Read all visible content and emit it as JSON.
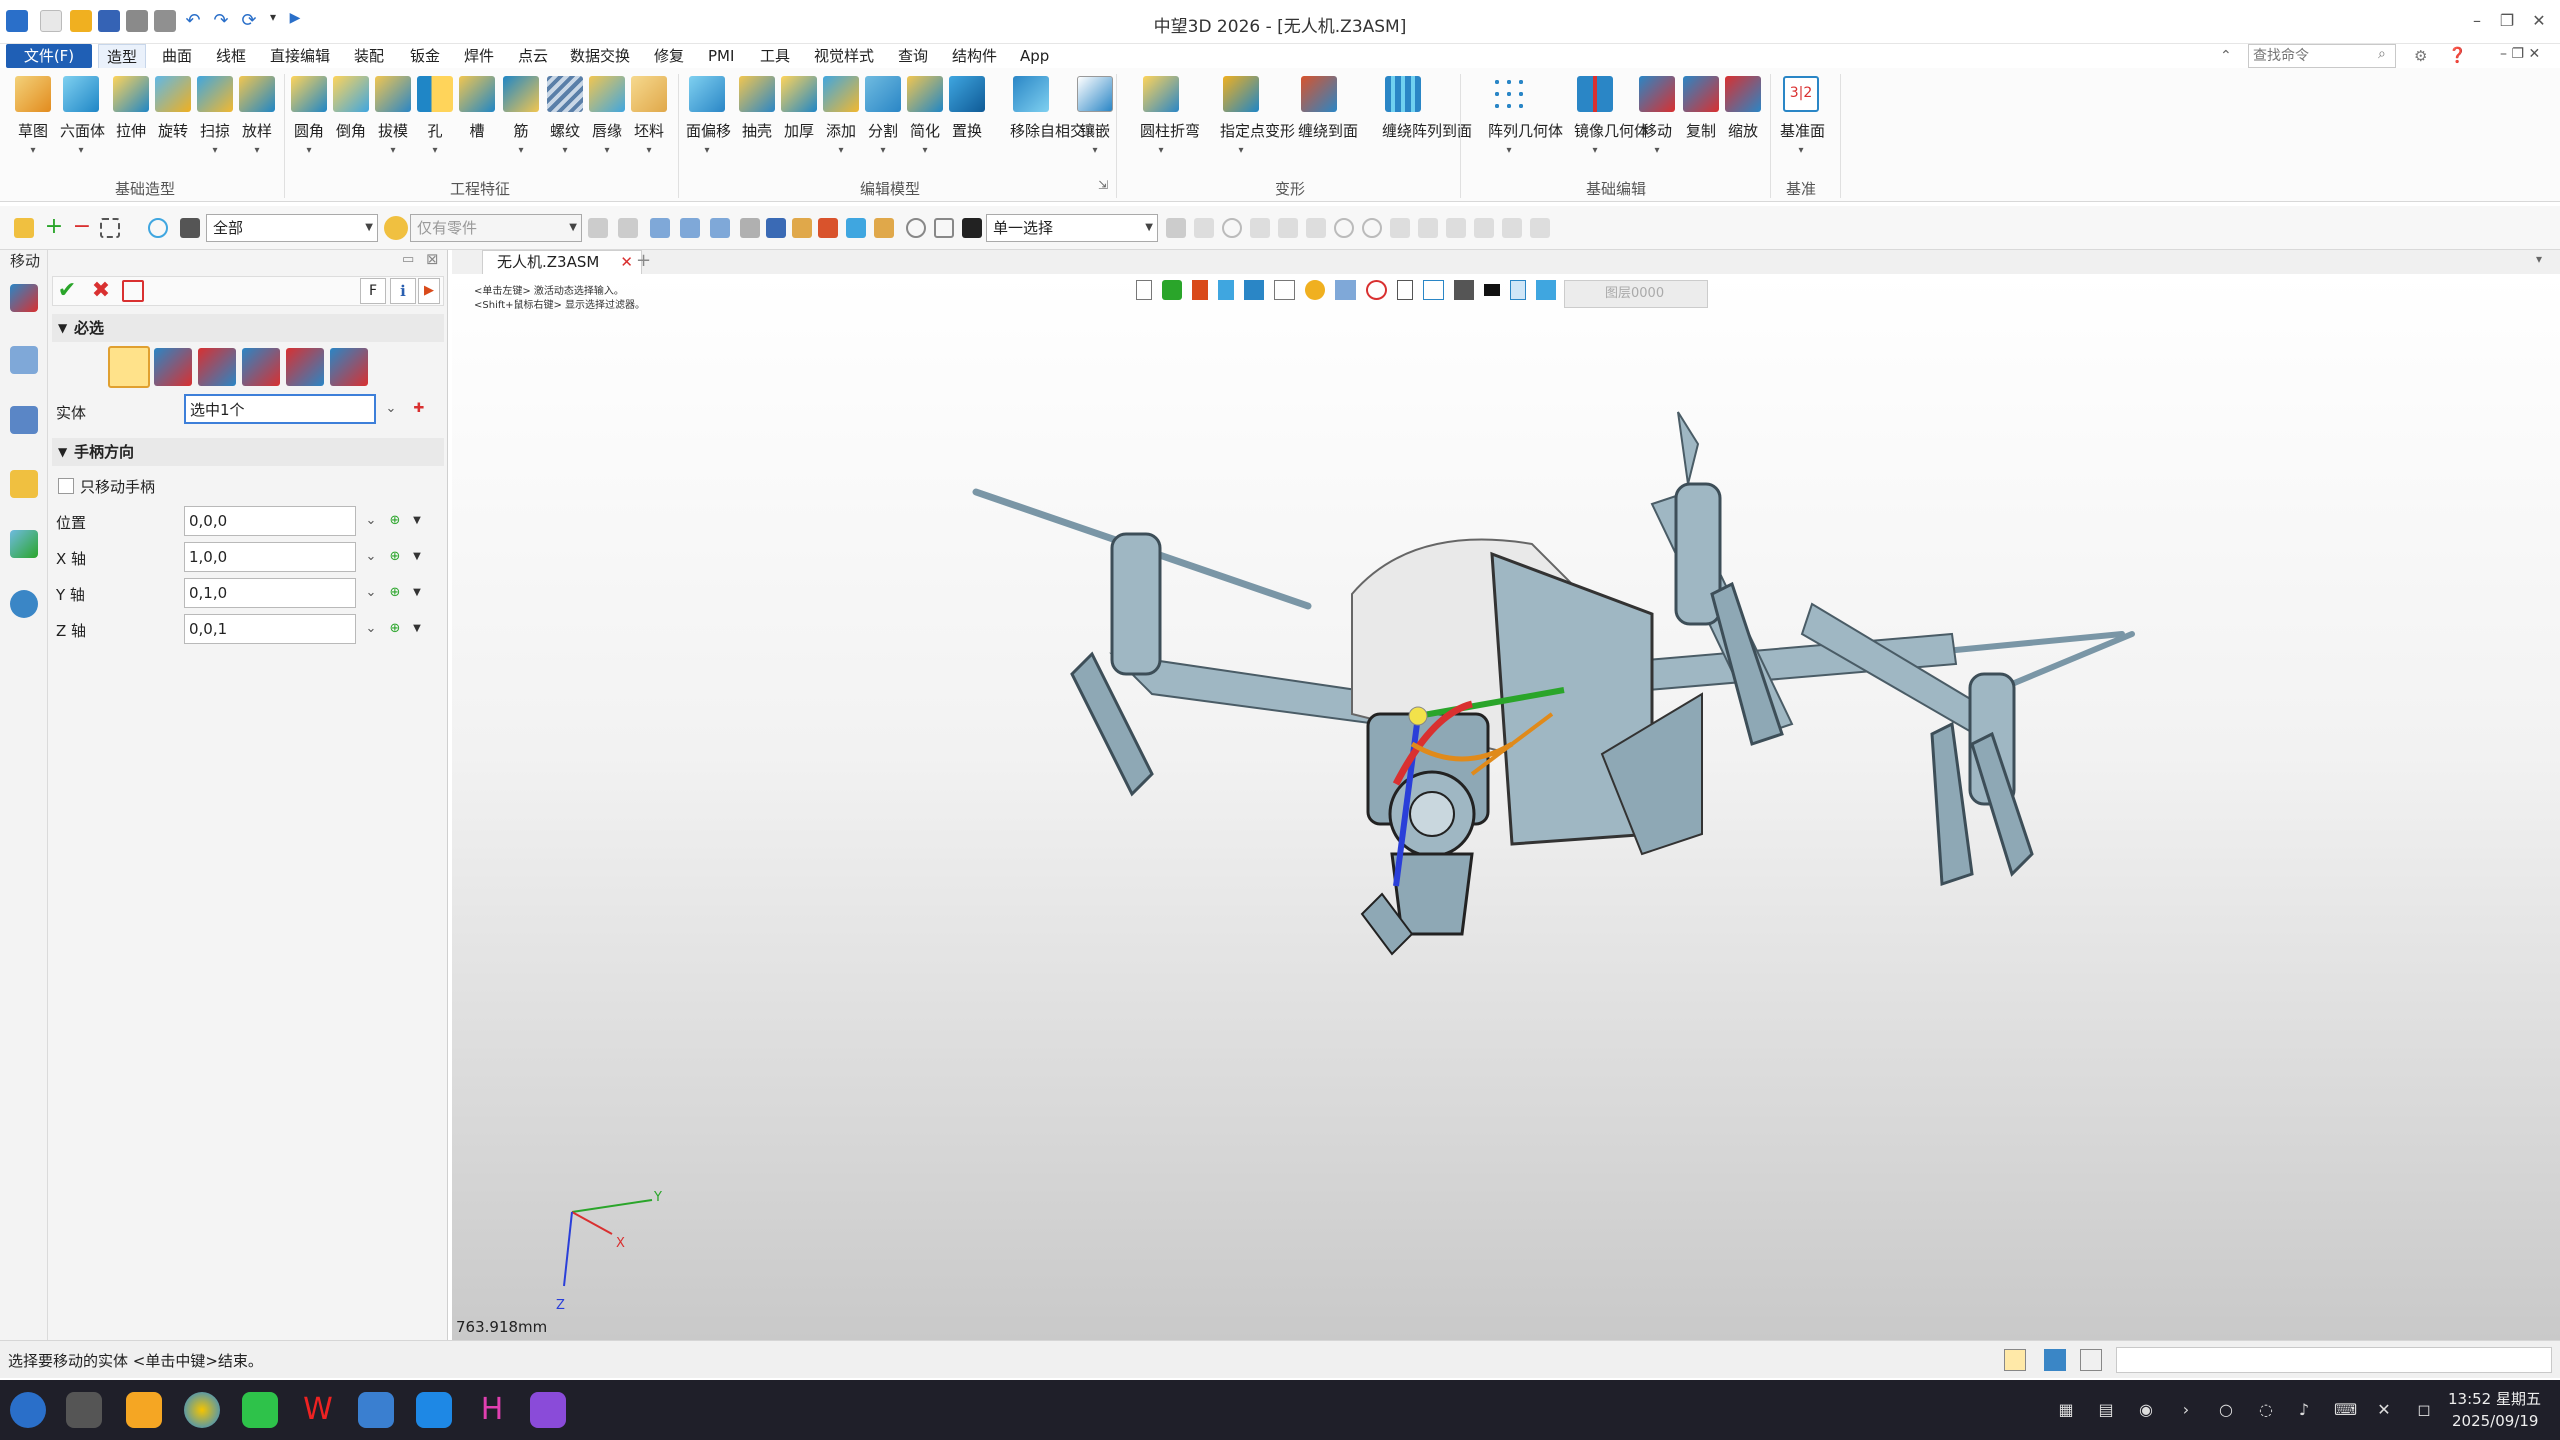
{
  "window": {
    "title": "中望3D 2026 - [无人机.Z3ASM]"
  },
  "menus": [
    "文件(F)",
    "造型",
    "曲面",
    "线框",
    "直接编辑",
    "装配",
    "钣金",
    "焊件",
    "点云",
    "数据交换",
    "修复",
    "PMI",
    "工具",
    "视觉样式",
    "查询",
    "结构件",
    "App"
  ],
  "search": {
    "placeholder": "查找命令"
  },
  "ribbon": {
    "groups": [
      {
        "label": "基础造型",
        "items": [
          "草图",
          "六面体",
          "拉伸",
          "旋转",
          "扫掠",
          "放样"
        ]
      },
      {
        "label": "工程特征",
        "items": [
          "圆角",
          "倒角",
          "拔模",
          "孔",
          "槽",
          "筋",
          "螺纹",
          "唇缘",
          "坯料"
        ]
      },
      {
        "label": "编辑模型",
        "items": [
          "面偏移",
          "抽壳",
          "加厚",
          "添加",
          "分割",
          "简化",
          "置换",
          "移除自相交",
          "镶嵌"
        ]
      },
      {
        "label": "变形",
        "items": [
          "圆柱折弯",
          "指定点变形",
          "缠绕到面",
          "缠绕阵列到面"
        ]
      },
      {
        "label": "基础编辑",
        "items": [
          "阵列几何体",
          "镜像几何体",
          "移动",
          "复制",
          "缩放"
        ]
      },
      {
        "label": "基准",
        "items": [
          "基准面"
        ]
      }
    ]
  },
  "toolbar": {
    "filter_value": "全部",
    "parts_placeholder": "仅有零件",
    "select_mode": "单一选择",
    "layer": "图层0000"
  },
  "panel": {
    "title": "移动",
    "flag_label": "F",
    "required_label": "必选",
    "entity_label": "实体",
    "entity_value": "选中1个",
    "handle_section": "手柄方向",
    "only_handle_label": "只移动手柄",
    "position_label": "位置",
    "position_value": "0,0,0",
    "xaxis_label": "X 轴",
    "xaxis_value": "1,0,0",
    "yaxis_label": "Y 轴",
    "yaxis_value": "0,1,0",
    "zaxis_label": "Z 轴",
    "zaxis_value": "0,0,1"
  },
  "document": {
    "tab": "无人机.Z3ASM",
    "hint1": "<单击左键> 激活动态选择输入。",
    "hint2": "<Shift+鼠标右键> 显示选择过滤器。",
    "scale": "763.918mm",
    "axis_x": "X",
    "axis_y": "Y",
    "axis_z": "Z"
  },
  "status": {
    "message": "选择要移动的实体 <单击中键>结束。"
  },
  "clock": {
    "time": "13:52 星期五",
    "date": "2025/09/19"
  },
  "colors": {
    "accent": "#1f5fb5",
    "model": "#9fb7c3",
    "axis_x": "#d93030",
    "axis_y": "#2aa52a",
    "axis_z": "#2a3fd9"
  }
}
